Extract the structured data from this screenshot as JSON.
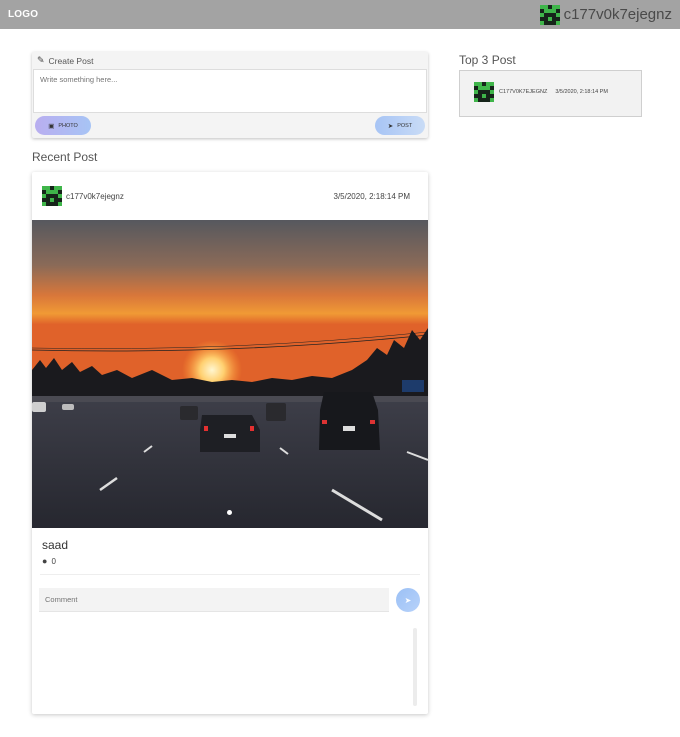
{
  "header": {
    "logo": "LOGO",
    "username": "c177v0k7ejegnz"
  },
  "create_post": {
    "title": "Create Post",
    "placeholder": "Write something here...",
    "photo_label": "PHOTO",
    "post_label": "POST"
  },
  "recent": {
    "title": "Recent Post",
    "post": {
      "username": "c177v0k7ejegnz",
      "date": "3/5/2020, 2:18:14 PM",
      "caption": "saad",
      "comment_count": "0",
      "comment_placeholder": "Comment"
    }
  },
  "top3": {
    "title": "Top 3 Post",
    "items": [
      {
        "username": "C177V0K7EJEGNZ",
        "date": "3/5/2020, 2:18:14 PM"
      }
    ]
  },
  "colors": {
    "topbar": "#a3a3a3",
    "accent": "#a7c4f5"
  },
  "icons": {
    "create": "pencil-icon",
    "photo": "image-icon",
    "post": "send-icon",
    "comments": "comment-bubble-icon",
    "comment_send": "send-icon"
  }
}
